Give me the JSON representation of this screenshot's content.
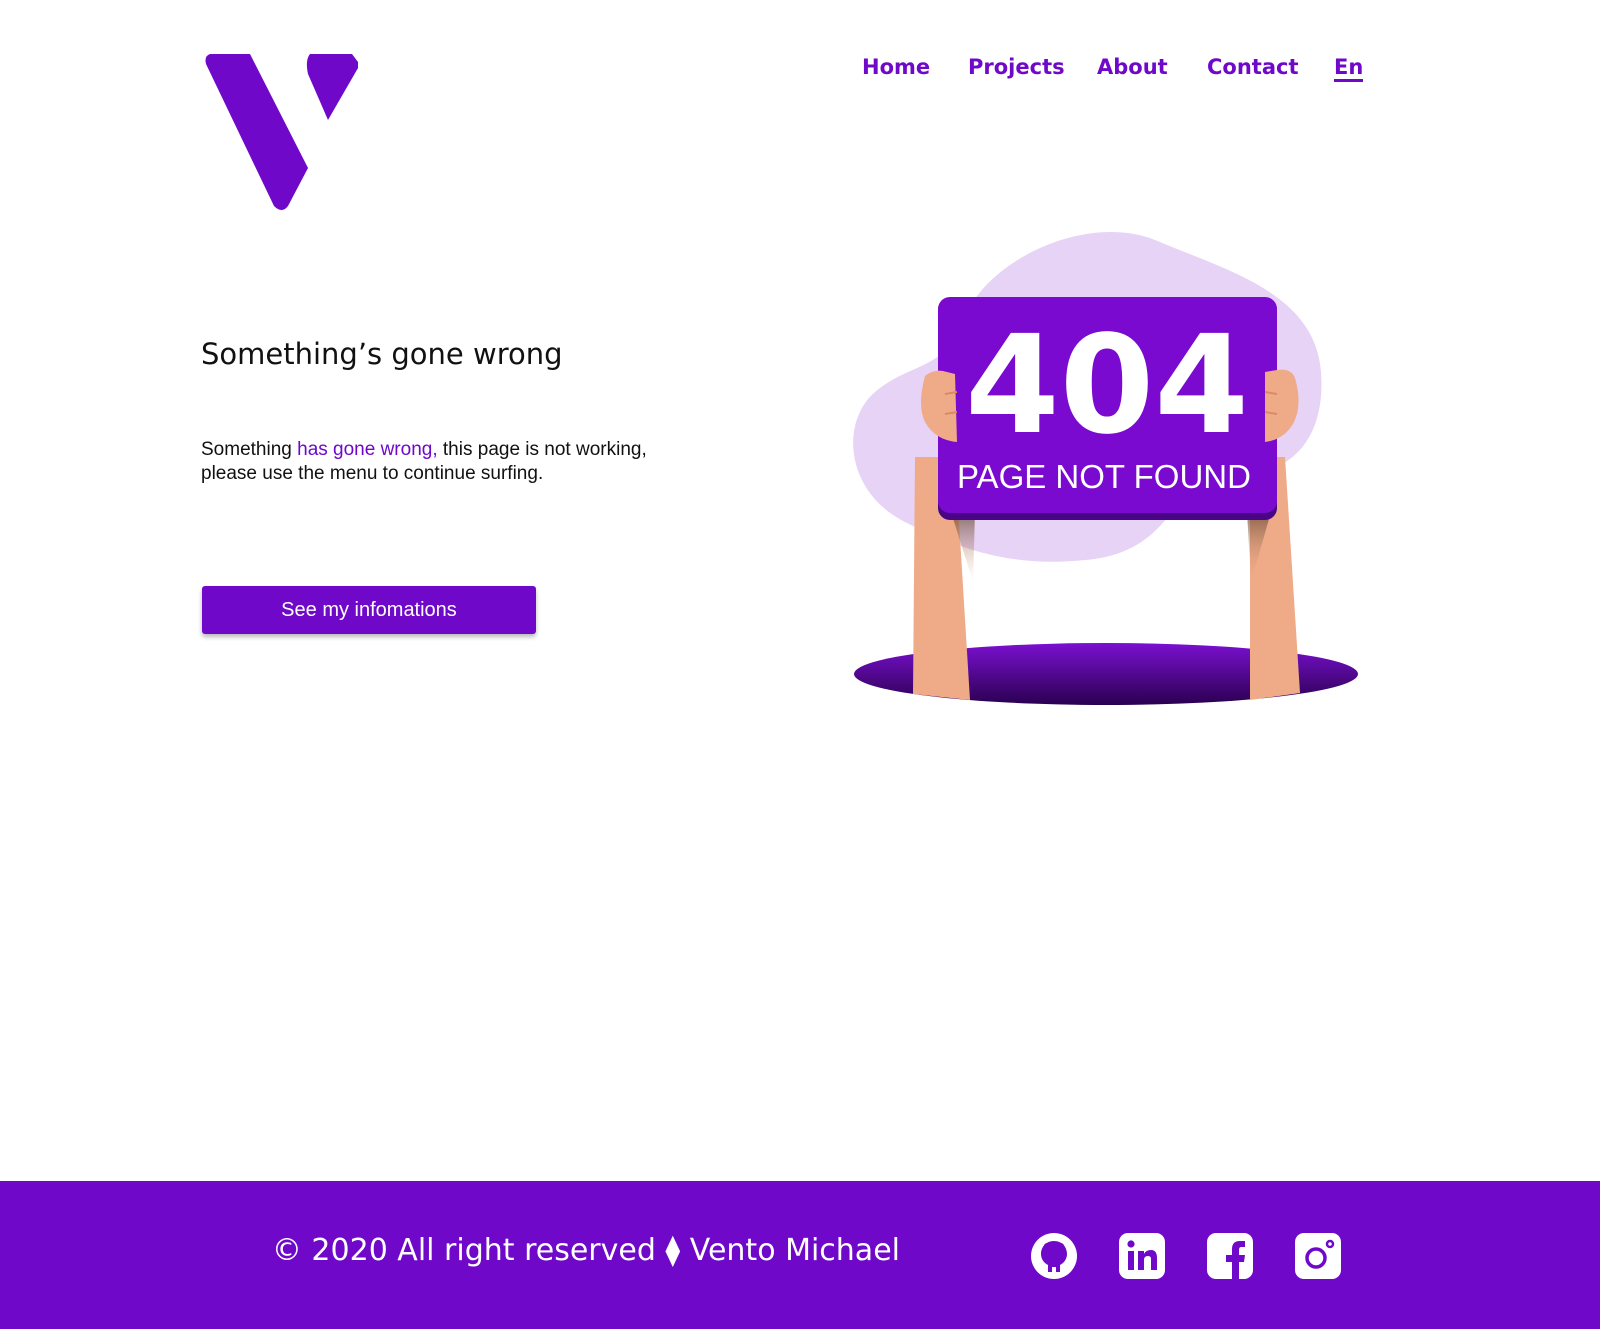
{
  "nav": {
    "items": [
      {
        "label": "Home"
      },
      {
        "label": "Projects"
      },
      {
        "label": "About"
      },
      {
        "label": "Contact"
      },
      {
        "label": "En",
        "active": true
      }
    ]
  },
  "main": {
    "title": "Something’s gone wrong",
    "description_before": "Something ",
    "description_highlight": "has gone wrong,",
    "description_after": "  this page is not working, please use the menu to continue surfing.",
    "cta_label": "See my infomations"
  },
  "illustration": {
    "code": "404",
    "caption": "PAGE NOT FOUND"
  },
  "footer": {
    "copyright": "© 2020 All right reserved ⧫ Vento Michael",
    "social_icons": [
      "github-icon",
      "linkedin-icon",
      "facebook-icon",
      "instagram-icon"
    ]
  },
  "colors": {
    "accent": "#6f08c9",
    "blob": "#e6d3f6",
    "skin": "#efaa87",
    "hole": "#2a0050"
  }
}
